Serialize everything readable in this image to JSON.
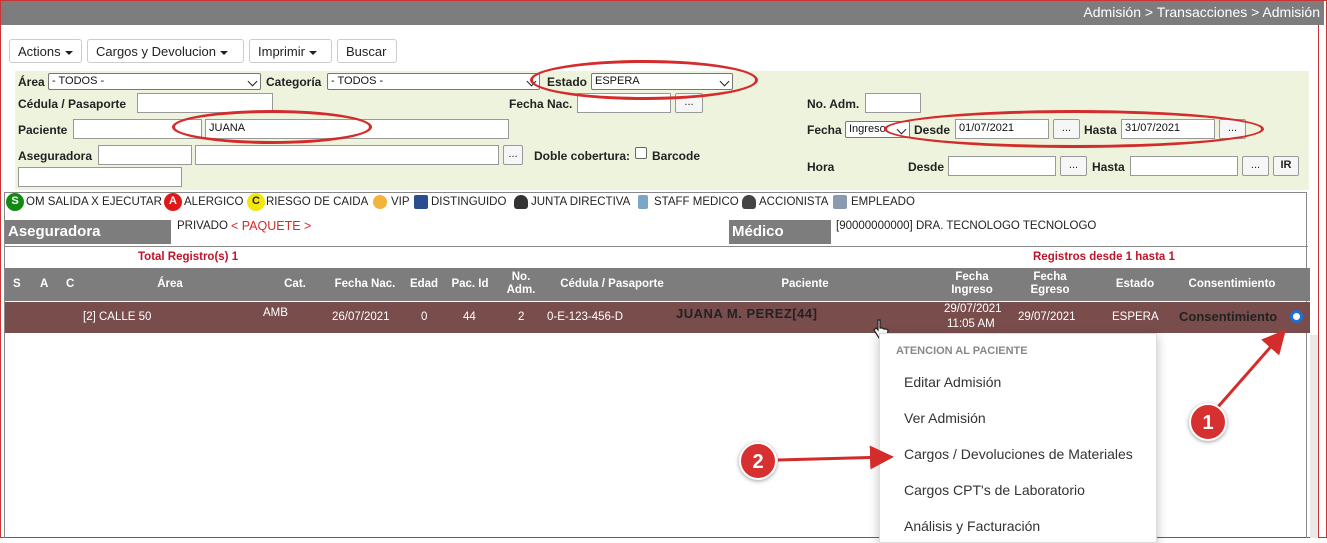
{
  "breadcrumb": "Admisión > Transacciones > Admisión",
  "toolbar": {
    "actions": "Actions",
    "cargos": "Cargos y Devolucion",
    "imprimir": "Imprimir",
    "buscar": "Buscar"
  },
  "filters": {
    "area_label": "Área",
    "area_value": "- TODOS -",
    "categoria_label": "Categoría",
    "categoria_value": "- TODOS -",
    "estado_label": "Estado",
    "estado_value": "ESPERA",
    "cedula_label": "Cédula / Pasaporte",
    "fecha_nac_label": "Fecha Nac.",
    "no_adm_label": "No. Adm.",
    "paciente_label": "Paciente",
    "paciente_value": "JUANA",
    "fecha_label": "Fecha",
    "fecha_type": "Ingreso",
    "desde_label": "Desde",
    "desde_value": "01/07/2021",
    "hasta_label": "Hasta",
    "hasta_value": "31/07/2021",
    "aseguradora_label": "Aseguradora",
    "doble_label": "Doble cobertura:",
    "barcode_label": "Barcode",
    "hora_label": "Hora",
    "hora_desde_label": "Desde",
    "hora_hasta_label": "Hasta",
    "dots": "...",
    "ir": "IR"
  },
  "legend": {
    "s_letter": "S",
    "s_text": "OM SALIDA X EJECUTAR",
    "a_letter": "A",
    "a_text": "ALERGICO",
    "c_letter": "C",
    "c_text": "RIESGO DE CAIDA",
    "vip": "VIP",
    "distinguido": "DISTINGUIDO",
    "junta": "JUNTA DIRECTIVA",
    "staff": "STAFF MEDICO",
    "accionista": "ACCIONISTA",
    "empleado": "EMPLEADO"
  },
  "info": {
    "aseguradora_title": "Aseguradora",
    "aseguradora_value": "PRIVADO",
    "paquete": "< PAQUETE >",
    "medico_title": "Médico",
    "medico_value": "[90000000000] DRA. TECNOLOGO TECNOLOGO"
  },
  "summary": {
    "total": "Total Registro(s) 1",
    "range": "Registros desde 1 hasta 1"
  },
  "columns": {
    "s": "S",
    "a": "A",
    "c": "C",
    "area": "Área",
    "cat": "Cat.",
    "fecha_nac": "Fecha Nac.",
    "edad": "Edad",
    "pac_id": "Pac. Id",
    "no_adm_1": "No.",
    "no_adm_2": "Adm.",
    "cedula": "Cédula / Pasaporte",
    "paciente": "Paciente",
    "fecha_ingreso_1": "Fecha",
    "fecha_ingreso_2": "Ingreso",
    "fecha_egreso_1": "Fecha",
    "fecha_egreso_2": "Egreso",
    "estado": "Estado",
    "consentimiento": "Consentimiento"
  },
  "row": {
    "area": "[2] CALLE 50",
    "cat": "AMB",
    "fecha_nac": "26/07/2021",
    "edad": "0",
    "pac_id": "44",
    "no_adm": "2",
    "cedula": "0-E-123-456-D",
    "paciente": "JUANA M. PEREZ[44]",
    "ingreso_date": "29/07/2021",
    "ingreso_time": "11:05 AM",
    "egreso": "29/07/2021",
    "estado": "ESPERA",
    "consentimiento": "Consentimiento"
  },
  "context_menu": {
    "header": "ATENCION AL PACIENTE",
    "items": [
      "Editar Admisión",
      "Ver Admisión",
      "Cargos / Devoluciones de Materiales",
      "Cargos CPT's de Laboratorio",
      "Análisis y Facturación"
    ]
  },
  "annotations": {
    "badge1": "1",
    "badge2": "2"
  },
  "colors": {
    "accent_red": "#d42b2b",
    "header_gray": "#7d7d7d",
    "row_brown": "#7a4d4d",
    "filter_bg": "#eef3dd"
  }
}
